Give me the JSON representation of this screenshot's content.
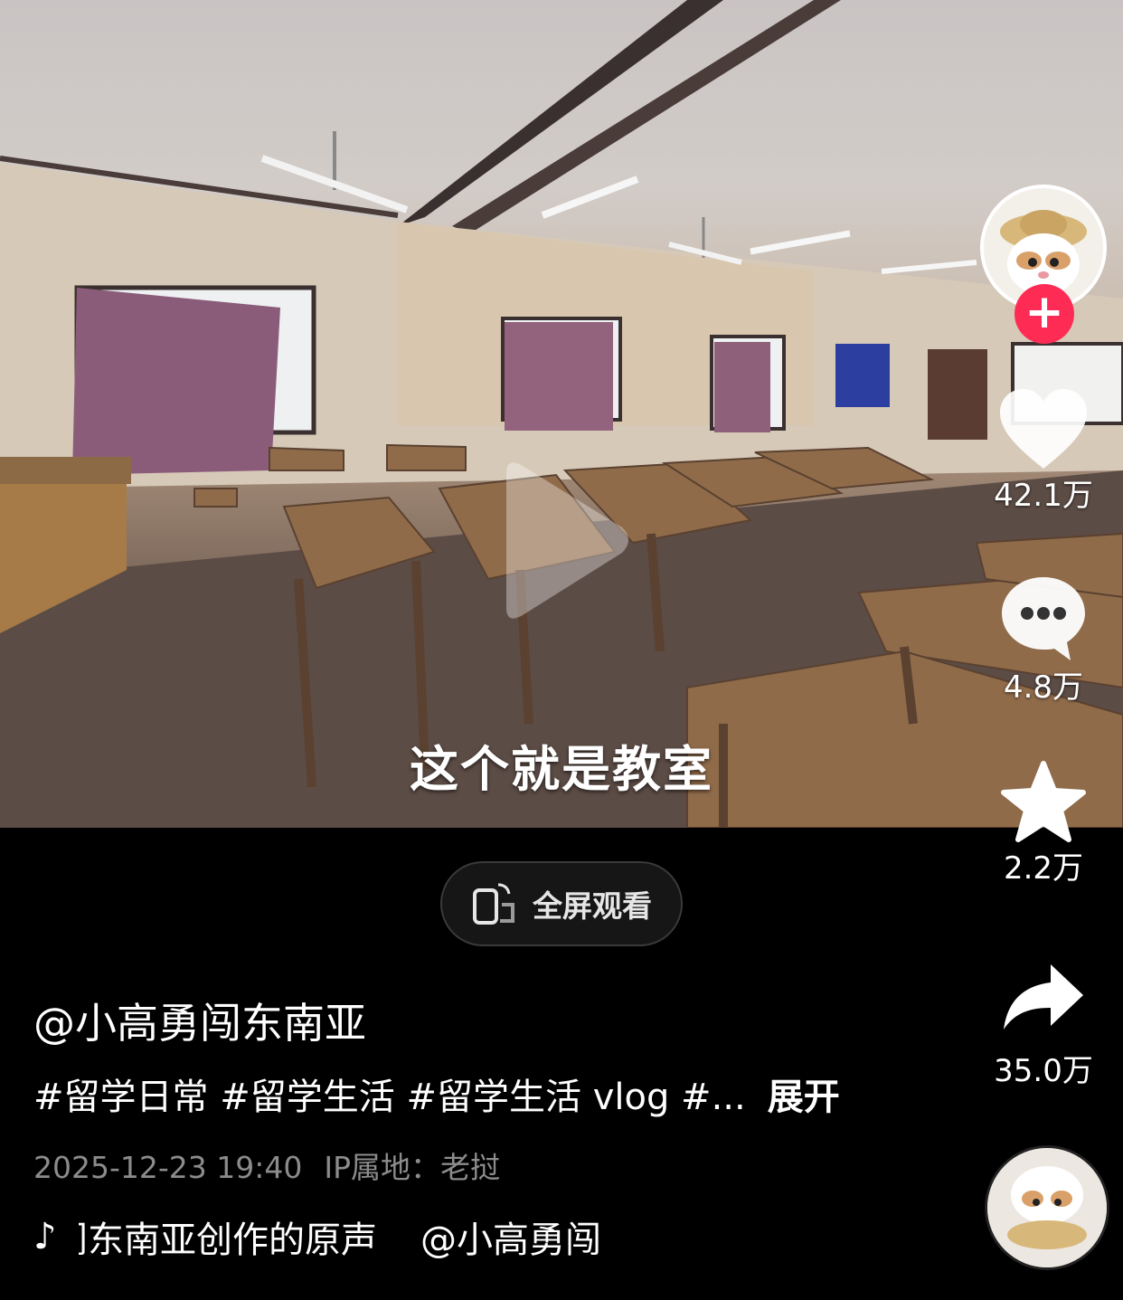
{
  "video": {
    "subtitle": "这个就是教室"
  },
  "rail": {
    "like_count": "42.1万",
    "comment_count": "4.8万",
    "favorite_count": "2.2万",
    "share_count": "35.0万",
    "follow_symbol": "+"
  },
  "fullscreen": {
    "label": "全屏观看"
  },
  "post": {
    "author": "@小高勇闯东南亚",
    "description": "#留学日常 #留学生活 #留学生活 vlog #...",
    "expand_label": "展开",
    "date": "2025-12-23 19:40",
    "ip_location": "IP属地：老挝"
  },
  "music": {
    "note_icon": "♪",
    "title_part1": "闯东南亚创作的原声",
    "title_part2": "@小高勇闯"
  },
  "colors": {
    "follow_button": "#fe2c55",
    "meta_text": "#8c8c8c",
    "background": "#000000"
  },
  "icons": [
    "play-icon",
    "heart-icon",
    "comment-icon",
    "star-icon",
    "share-icon",
    "fullscreen-icon",
    "music-note-icon"
  ]
}
